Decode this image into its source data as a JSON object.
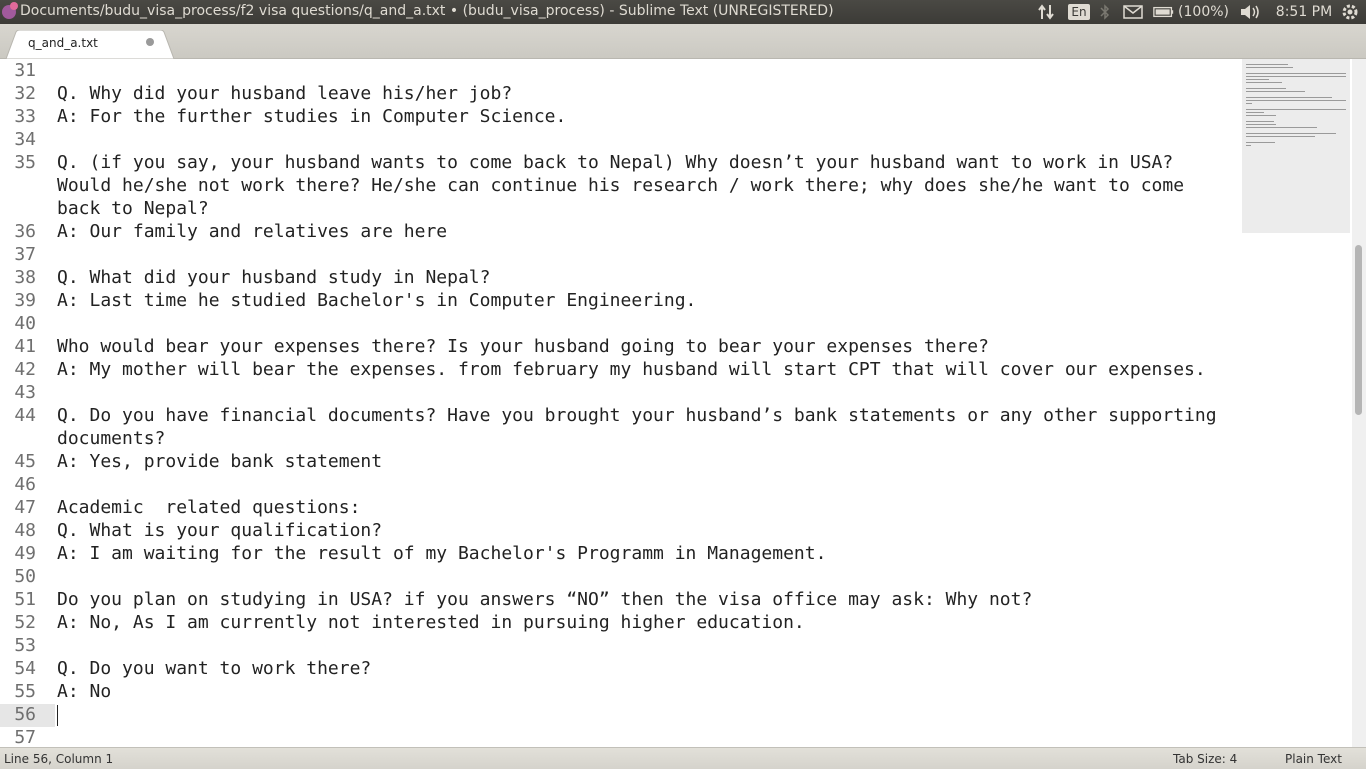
{
  "window": {
    "title": "Documents/budu_visa_process/f2 visa questions/q_and_a.txt • (budu_visa_process) - Sublime Text (UNREGISTERED)"
  },
  "tray": {
    "keyboard": "En",
    "battery": "(100%)",
    "time": "8:51 PM"
  },
  "tab": {
    "label": "q_and_a.txt"
  },
  "editor": {
    "lines": [
      {
        "num": "31",
        "text": ""
      },
      {
        "num": "32",
        "text": "Q. Why did your husband leave his/her job?"
      },
      {
        "num": "33",
        "text": "A: For the further studies in Computer Science."
      },
      {
        "num": "34",
        "text": ""
      },
      {
        "num": "35",
        "text": "Q. (if you say, your husband wants to come back to Nepal) Why doesn’t your husband want to work in USA? Would he/she not work there? He/she can continue his research / work there; why does she/he want to come back to Nepal?"
      },
      {
        "num": "36",
        "text": "A: Our family and relatives are here"
      },
      {
        "num": "37",
        "text": ""
      },
      {
        "num": "38",
        "text": "Q. What did your husband study in Nepal?"
      },
      {
        "num": "39",
        "text": "A: Last time he studied Bachelor's in Computer Engineering."
      },
      {
        "num": "40",
        "text": ""
      },
      {
        "num": "41",
        "text": "Who would bear your expenses there? Is your husband going to bear your expenses there?"
      },
      {
        "num": "42",
        "text": "A: My mother will bear the expenses. from february my husband will start CPT that will cover our expenses."
      },
      {
        "num": "43",
        "text": ""
      },
      {
        "num": "44",
        "text": "Q. Do you have financial documents? Have you brought your husband’s bank statements or any other supporting documents?"
      },
      {
        "num": "45",
        "text": "A: Yes, provide bank statement"
      },
      {
        "num": "46",
        "text": ""
      },
      {
        "num": "47",
        "text": "Academic  related questions:"
      },
      {
        "num": "48",
        "text": "Q. What is your qualification?"
      },
      {
        "num": "49",
        "text": "A: I am waiting for the result of my Bachelor's Programm in Management."
      },
      {
        "num": "50",
        "text": ""
      },
      {
        "num": "51",
        "text": "Do you plan on studying in USA? if you answers “NO” then the visa office may ask: Why not?"
      },
      {
        "num": "52",
        "text": "A: No, As I am currently not interested in pursuing higher education."
      },
      {
        "num": "53",
        "text": ""
      },
      {
        "num": "54",
        "text": "Q. Do you want to work there?"
      },
      {
        "num": "55",
        "text": "A: No"
      },
      {
        "num": "56",
        "text": ""
      },
      {
        "num": "57",
        "text": ""
      }
    ]
  },
  "statusbar": {
    "position": "Line 56, Column 1",
    "tab_size": "Tab Size: 4",
    "syntax": "Plain Text"
  }
}
